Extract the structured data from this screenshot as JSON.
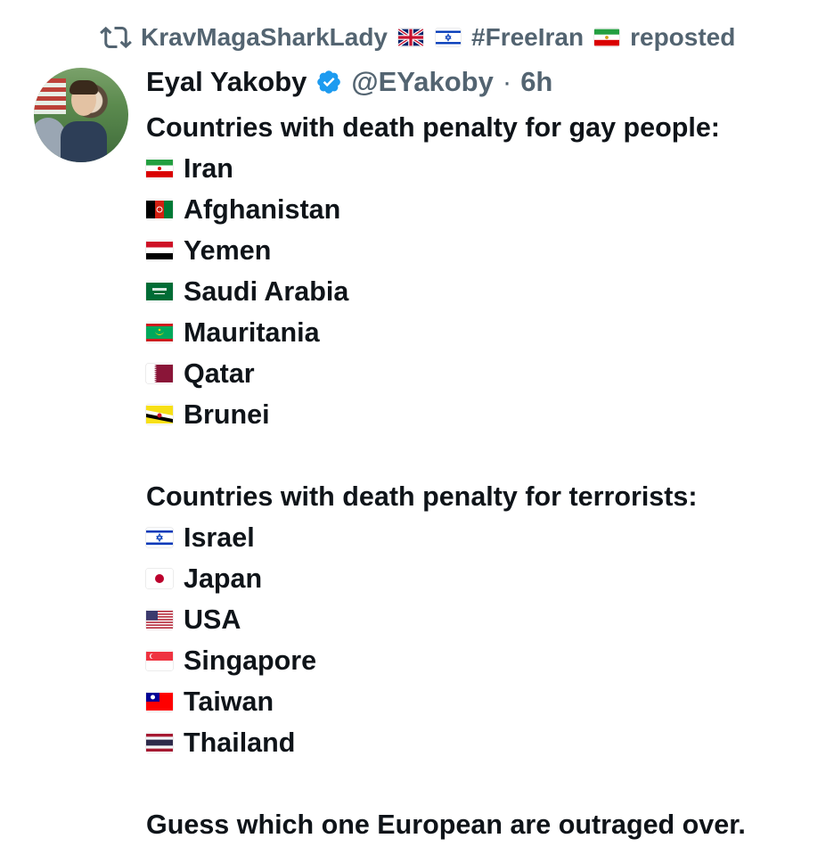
{
  "repost": {
    "user": "KravMagaSharkLady",
    "hashtag": "#FreeIran",
    "suffix": "reposted"
  },
  "author": {
    "name": "Eyal Yakoby",
    "handle": "@EYakoby",
    "separator": "·",
    "time": "6h"
  },
  "post": {
    "heading1": "Countries with death penalty for gay people:",
    "list1": [
      "Iran",
      "Afghanistan",
      "Yemen",
      "Saudi Arabia",
      "Mauritania",
      "Qatar",
      "Brunei"
    ],
    "heading2": "Countries with death penalty for terrorists:",
    "list2": [
      "Israel",
      "Japan",
      "USA",
      "Singapore",
      "Taiwan",
      "Thailand"
    ],
    "closing": "Guess which one European are outraged over."
  },
  "colors": {
    "text": "#0f1419",
    "muted": "#536471",
    "verified": "#1d9bf0"
  },
  "icons": {
    "repost": "repost-icon",
    "verified": "verified-badge-icon",
    "flags_repost_line": [
      "uk-flag-icon",
      "israel-flag-icon",
      "iran-lion-sun-flag-icon"
    ],
    "flags_list1": [
      "iran-flag-icon",
      "afghanistan-flag-icon",
      "yemen-flag-icon",
      "saudi-arabia-flag-icon",
      "mauritania-flag-icon",
      "qatar-flag-icon",
      "brunei-flag-icon"
    ],
    "flags_list2": [
      "israel-flag-icon",
      "japan-flag-icon",
      "usa-flag-icon",
      "singapore-flag-icon",
      "taiwan-flag-icon",
      "thailand-flag-icon"
    ]
  }
}
